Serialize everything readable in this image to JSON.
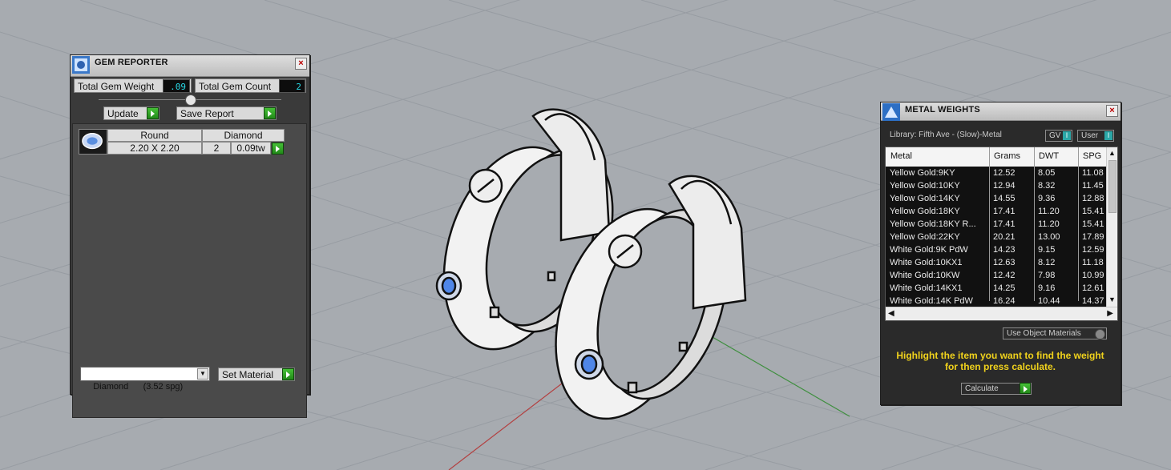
{
  "gem_reporter": {
    "title": "GEM REPORTER",
    "total_weight_label": "Total Gem Weight",
    "total_weight_value": ".09",
    "total_count_label": "Total Gem Count",
    "total_count_value": "2",
    "update_label": "Update",
    "save_report_label": "Save Report",
    "gem": {
      "shape": "Round",
      "material": "Diamond",
      "size": "2.20 X 2.20",
      "count": "2",
      "weight": "0.09tw"
    },
    "material_select_value": "Diamond      (3.52 spg)",
    "set_material_label": "Set Material"
  },
  "metal_weights": {
    "title": "METAL WEIGHTS",
    "library": "Library: Fifth Ave - (Slow)-Metal",
    "gv_label": "GV",
    "user_label": "User",
    "columns": [
      "Metal",
      "Grams",
      "DWT",
      "SPG"
    ],
    "rows": [
      {
        "metal": "Yellow Gold:9KY",
        "grams": "12.52",
        "dwt": "8.05",
        "spg": "11.08"
      },
      {
        "metal": "Yellow Gold:10KY",
        "grams": "12.94",
        "dwt": "8.32",
        "spg": "11.45"
      },
      {
        "metal": "Yellow Gold:14KY",
        "grams": "14.55",
        "dwt": "9.36",
        "spg": "12.88"
      },
      {
        "metal": "Yellow Gold:18KY",
        "grams": "17.41",
        "dwt": "11.20",
        "spg": "15.41"
      },
      {
        "metal": "Yellow Gold:18KY R...",
        "grams": "17.41",
        "dwt": "11.20",
        "spg": "15.41"
      },
      {
        "metal": "Yellow Gold:22KY",
        "grams": "20.21",
        "dwt": "13.00",
        "spg": "17.89"
      },
      {
        "metal": "White Gold:9K PdW",
        "grams": "14.23",
        "dwt": "9.15",
        "spg": "12.59"
      },
      {
        "metal": "White Gold:10KX1",
        "grams": "12.63",
        "dwt": "8.12",
        "spg": "11.18"
      },
      {
        "metal": "White Gold:10KW",
        "grams": "12.42",
        "dwt": "7.98",
        "spg": "10.99"
      },
      {
        "metal": "White Gold:14KX1",
        "grams": "14.25",
        "dwt": "9.16",
        "spg": "12.61"
      },
      {
        "metal": "White Gold:14K PdW",
        "grams": "16.24",
        "dwt": "10.44",
        "spg": "14.37"
      }
    ],
    "use_object_materials_label": "Use Object Materials",
    "instruction": "Highlight the item you want to find the weight for then press calculate.",
    "calculate_label": "Calculate"
  },
  "colors": {
    "viewport_bg": "#a7abb0",
    "panel_bg": "#3a3a3a",
    "value_text": "#29d9e6",
    "instruction_text": "#f0d21c",
    "accent_green": "#2fa424",
    "gem_blue": "#4f86e8"
  }
}
